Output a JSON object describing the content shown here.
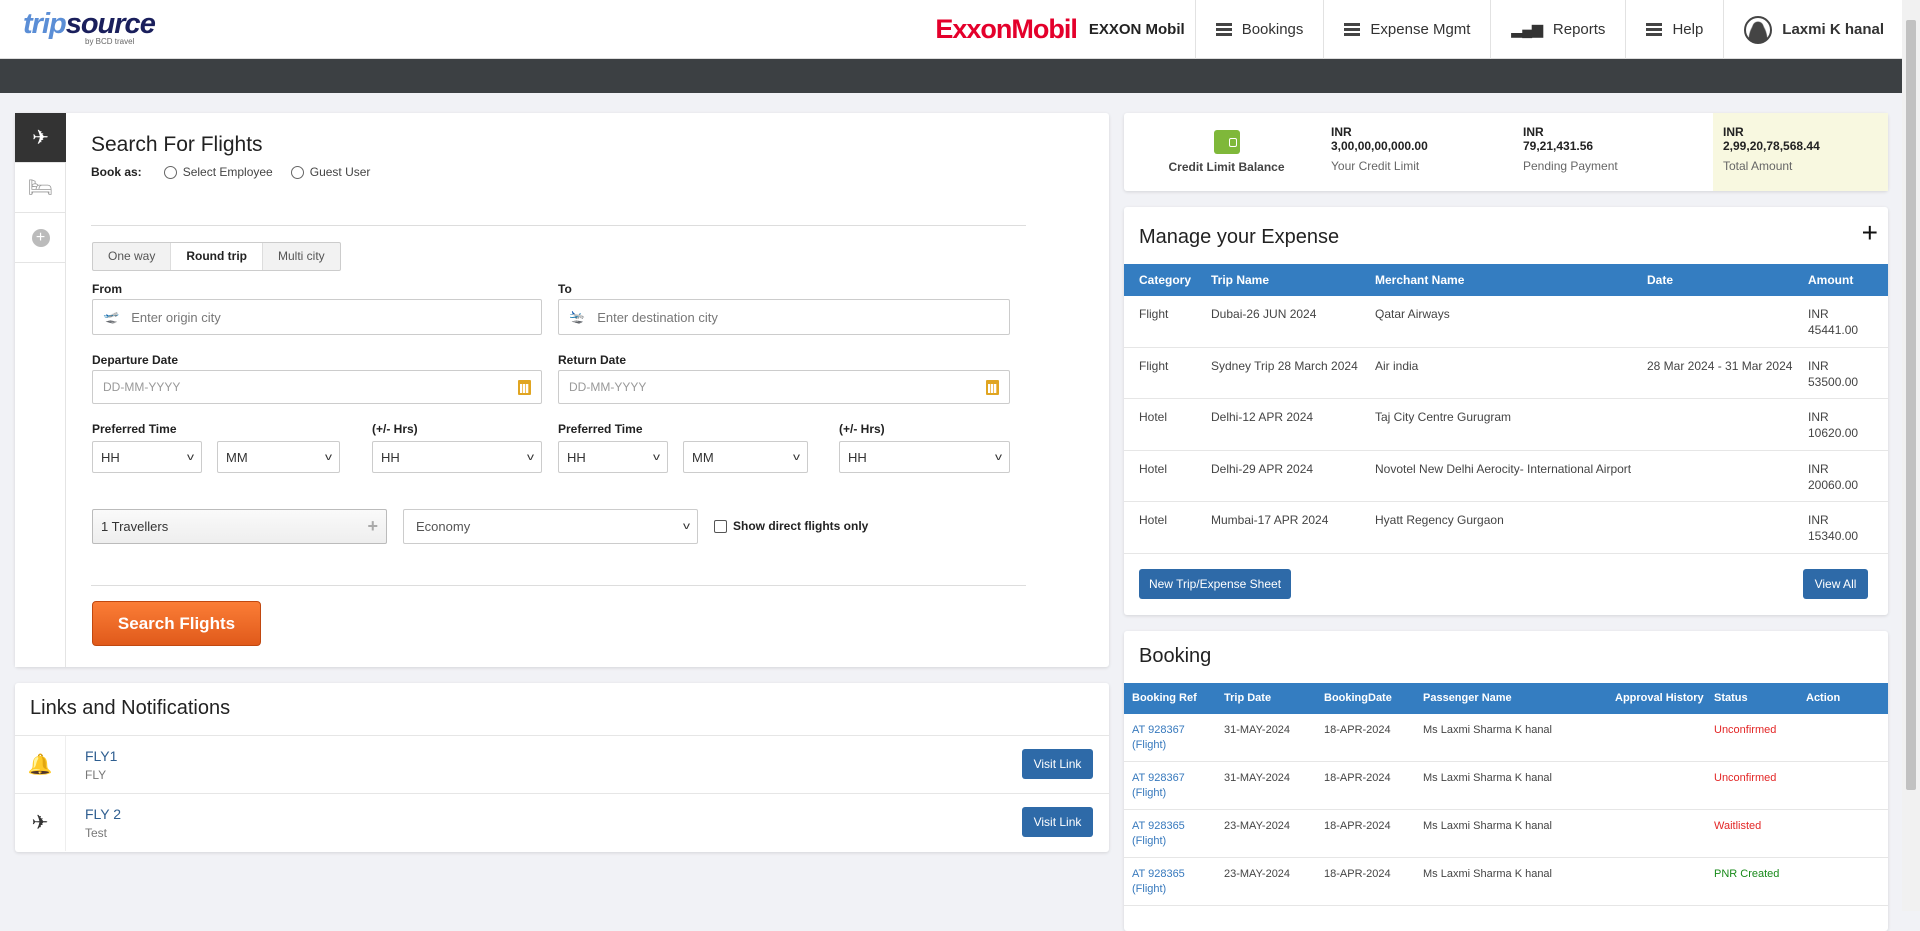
{
  "header": {
    "logo": "tripsource",
    "logo_sub": "by BCD travel",
    "client_logo": "ExxonMobil",
    "client_name": "EXXON Mobil",
    "nav": [
      {
        "label": "Bookings",
        "icon": "menu-icon"
      },
      {
        "label": "Expense Mgmt",
        "icon": "menu-icon"
      },
      {
        "label": "Reports",
        "icon": "bar-chart-icon"
      },
      {
        "label": "Help",
        "icon": "menu-icon"
      }
    ],
    "user": "Laxmi K hanal"
  },
  "search": {
    "title": "Search For Flights",
    "book_as": "Book as:",
    "radio_employee": "Select Employee",
    "radio_guest": "Guest User",
    "trip_types": [
      "One way",
      "Round trip",
      "Multi city"
    ],
    "selected_trip_type": "Round trip",
    "from_label": "From",
    "from_placeholder": "Enter origin city",
    "to_label": "To",
    "to_placeholder": "Enter destination city",
    "departure_label": "Departure Date",
    "return_label": "Return Date",
    "date_placeholder": "DD-MM-YYYY",
    "pref_time_label": "Preferred Time",
    "hrs_label": "(+/- Hrs)",
    "hh": "HH",
    "mm": "MM",
    "travellers": "1 Travellers",
    "cabin": "Economy",
    "direct_only": "Show direct flights only",
    "search_button": "Search Flights"
  },
  "links": {
    "title": "Links and Notifications",
    "items": [
      {
        "title": "FLY1",
        "subtitle": "FLY",
        "button": "Visit Link",
        "icon": "bell-icon"
      },
      {
        "title": "FLY 2",
        "subtitle": "Test",
        "button": "Visit Link",
        "icon": "plane-icon"
      }
    ]
  },
  "credit": {
    "label": "Credit Limit Balance",
    "limit": {
      "currency": "INR",
      "value": "3,00,00,00,000.00",
      "desc": "Your Credit Limit"
    },
    "pending": {
      "currency": "INR",
      "value": "79,21,431.56",
      "desc": "Pending Payment"
    },
    "total": {
      "currency": "INR",
      "value": "2,99,20,78,568.44",
      "desc": "Total Amount"
    }
  },
  "expense": {
    "title": "Manage your Expense",
    "headers": [
      "Category",
      "Trip Name",
      "Merchant Name",
      "Date",
      "Amount"
    ],
    "rows": [
      [
        "Flight",
        "Dubai-26 JUN 2024",
        "Qatar Airways",
        "",
        "INR 45441.00"
      ],
      [
        "Flight",
        "Sydney Trip 28 March 2024",
        "Air india",
        "28 Mar 2024 - 31 Mar 2024",
        "INR 53500.00"
      ],
      [
        "Hotel",
        "Delhi-12 APR 2024",
        "Taj City Centre Gurugram",
        "",
        "INR 10620.00"
      ],
      [
        "Hotel",
        "Delhi-29 APR 2024",
        "Novotel New Delhi Aerocity- International Airport",
        "",
        "INR 20060.00"
      ],
      [
        "Hotel",
        "Mumbai-17 APR 2024",
        "Hyatt Regency Gurgaon",
        "",
        "INR 15340.00"
      ]
    ],
    "new_button": "New Trip/Expense Sheet",
    "view_all": "View All"
  },
  "booking": {
    "title": "Booking",
    "headers": [
      "Booking Ref",
      "Trip Date",
      "BookingDate",
      "Passenger Name",
      "Approval History",
      "Status",
      "Action"
    ],
    "rows": [
      [
        "AT 928367 (Flight)",
        "31-MAY-2024",
        "18-APR-2024",
        "Ms Laxmi Sharma K hanal",
        "",
        "Unconfirmed"
      ],
      [
        "AT 928367 (Flight)",
        "31-MAY-2024",
        "18-APR-2024",
        "Ms Laxmi Sharma K hanal",
        "",
        "Unconfirmed"
      ],
      [
        "AT 928365 (Flight)",
        "23-MAY-2024",
        "18-APR-2024",
        "Ms Laxmi Sharma K hanal",
        "",
        "Waitlisted"
      ],
      [
        "AT 928365 (Flight)",
        "23-MAY-2024",
        "18-APR-2024",
        "Ms Laxmi Sharma K hanal",
        "",
        "PNR Created"
      ]
    ]
  },
  "colors": {
    "accent": "#347dc1",
    "button": "#2e6aa8",
    "search": "#f06a28",
    "unconfirmed": "#e32626",
    "pnr": "#188a1a"
  }
}
